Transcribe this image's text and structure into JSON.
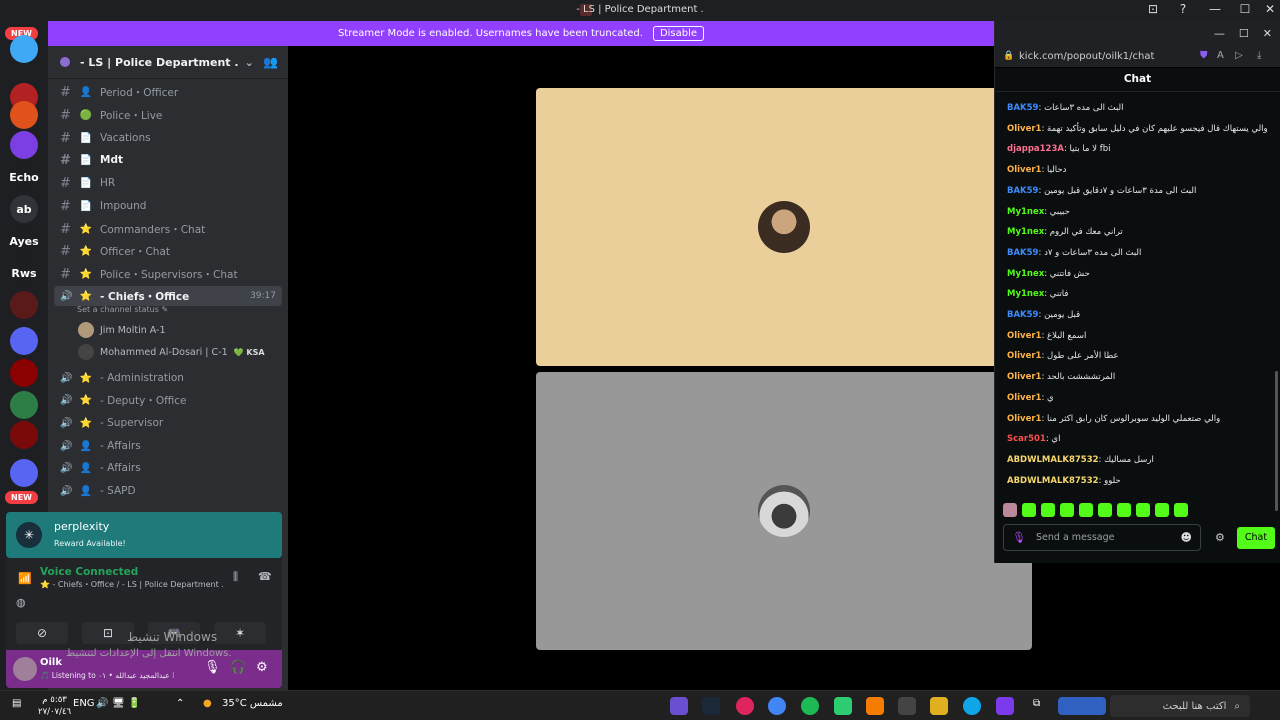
{
  "window": {
    "title": "- LS | Police Department .",
    "controls": [
      "⊡",
      "?",
      "—",
      "☐",
      "✕"
    ]
  },
  "rail": {
    "new_label": "NEW",
    "servers": [
      {
        "label": "",
        "color": "#3fa9f5",
        "badge": "1"
      },
      {
        "label": "",
        "color": "#b22222",
        "badge": "6"
      },
      {
        "label": "",
        "color": "#e0521b",
        "badge": "65"
      },
      {
        "label": "",
        "color": "#7b3fe4",
        "badge": ""
      },
      {
        "label": "Echo",
        "color": "#1e1f22",
        "badge": ""
      },
      {
        "label": "ab",
        "color": "#313338",
        "badge": ""
      },
      {
        "label": "Ayes",
        "color": "#1e1f22",
        "badge": "1"
      },
      {
        "label": "Rws",
        "color": "#1e1f22",
        "badge": "45"
      },
      {
        "label": "",
        "color": "#5a1a1a",
        "badge": "3"
      },
      {
        "label": "",
        "color": "#5865f2",
        "badge": ""
      },
      {
        "label": "",
        "color": "#8b0000",
        "badge": "1"
      },
      {
        "label": "",
        "color": "#2d7d46",
        "badge": "1"
      },
      {
        "label": "",
        "color": "#7a0a0a",
        "badge": ""
      },
      {
        "label": "",
        "color": "#5865f2",
        "badge": ""
      }
    ]
  },
  "banner": {
    "text": "Streamer Mode is enabled. Usernames have been truncated.",
    "disable_label": "Disable"
  },
  "guild": {
    "name": "- LS | Police Department .",
    "channels": [
      {
        "type": "text",
        "emoji": "👤",
        "label": "Period・Officer",
        "style": ""
      },
      {
        "type": "text",
        "emoji": "🟢",
        "label": "Police・Live",
        "style": ""
      },
      {
        "type": "text",
        "emoji": "📄",
        "label": "Vacations",
        "style": ""
      },
      {
        "type": "text",
        "emoji": "📄",
        "label": "Mdt",
        "style": "bold"
      },
      {
        "type": "text",
        "emoji": "📄",
        "label": "HR",
        "style": ""
      },
      {
        "type": "text",
        "emoji": "📄",
        "label": "Impound",
        "style": ""
      },
      {
        "type": "text",
        "emoji": "⭐",
        "label": "Commanders・Chat",
        "style": ""
      },
      {
        "type": "text",
        "emoji": "⭐",
        "label": "Officer・Chat",
        "style": ""
      },
      {
        "type": "text",
        "emoji": "⭐",
        "label": "Police・Supervisors・Chat",
        "style": ""
      },
      {
        "type": "voice",
        "emoji": "⭐",
        "label": "- Chiefs・Office",
        "style": "active",
        "timer": "39:17"
      },
      {
        "type": "voice",
        "emoji": "⭐",
        "label": "- Administration",
        "style": ""
      },
      {
        "type": "voice",
        "emoji": "⭐",
        "label": "- Deputy・Office",
        "style": ""
      },
      {
        "type": "voice",
        "emoji": "⭐",
        "label": "- Supervisor",
        "style": ""
      },
      {
        "type": "voice",
        "emoji": "👤",
        "label": "- Affairs",
        "style": ""
      },
      {
        "type": "voice",
        "emoji": "👤",
        "label": "- Affairs",
        "style": ""
      },
      {
        "type": "voice",
        "emoji": "👤",
        "label": "- SAPD",
        "style": ""
      }
    ],
    "channel_status": "Set a channel status ✎",
    "members": [
      {
        "name": "Jim Moltin A-1",
        "tag": ""
      },
      {
        "name": "Mohammed Al-Dosari | C-1",
        "tag": "💚 KSA"
      }
    ]
  },
  "perplexity": {
    "title": "perplexity",
    "subtitle": "Reward Available!"
  },
  "voice": {
    "connected": "Voice Connected",
    "location": "⭐ - Chiefs・Office / - LS | Police Department .",
    "buttons": [
      "⊘",
      "⊡",
      "🎮",
      "✶"
    ]
  },
  "watermark": {
    "line1": "تنشيط Windows",
    "line2": "انتقل إلى الإعدادات لتنشيط Windows."
  },
  "user": {
    "name": "Oilk",
    "status": "🎵 Listening to عبدالمجيد عبدالله • ٠١ ⁝"
  },
  "browser": {
    "controls": [
      "—",
      "☐",
      "✕"
    ],
    "url": "kick.com/popout/oilk1/chat"
  },
  "chat": {
    "title": "Chat",
    "messages": [
      {
        "user": "BAK59",
        "color": "#3d8cff",
        "text": "البث الى مده ٣ساعات"
      },
      {
        "user": "Oliver1",
        "color": "#ffb347",
        "text": "والي يستهاك قال فيجسو عليهم كان في دليل سابق وتأكيد تهمة"
      },
      {
        "user": "djappa123A",
        "color": "#ff6f91",
        "text": "لا ما بتيا fbi"
      },
      {
        "user": "Oliver1",
        "color": "#ffb347",
        "text": "دحاليا"
      },
      {
        "user": "BAK59",
        "color": "#3d8cff",
        "text": "البث الى مدة ٣ساعات و ٧دقايق قبل يومين"
      },
      {
        "user": "My1nex",
        "color": "#53fc18",
        "text": "حبيبي"
      },
      {
        "user": "My1nex",
        "color": "#53fc18",
        "text": "تراني معك في الروم"
      },
      {
        "user": "BAK59",
        "color": "#3d8cff",
        "text": "البث الى مده ٣ساعات و ٧د"
      },
      {
        "user": "My1nex",
        "color": "#53fc18",
        "text": "حش فاتتني"
      },
      {
        "user": "My1nex",
        "color": "#53fc18",
        "text": "فاتني"
      },
      {
        "user": "BAK59",
        "color": "#3d8cff",
        "text": "قبل يومين"
      },
      {
        "user": "Oliver1",
        "color": "#ffb347",
        "text": "اسمع البلاغ"
      },
      {
        "user": "Oliver1",
        "color": "#ffb347",
        "text": "عطا الأمر على طول"
      },
      {
        "user": "Oliver1",
        "color": "#ffb347",
        "text": "المرتشششت بالحد"
      },
      {
        "user": "Oliver1",
        "color": "#ffb347",
        "text": "ي"
      },
      {
        "user": "Oliver1",
        "color": "#ffb347",
        "text": "والي صتعملي الوليد سوبرالوس كان رابق اكثر منا"
      },
      {
        "user": "Scar501",
        "color": "#ff4d4d",
        "text": "اي"
      },
      {
        "user": "ABDWLMALK87532",
        "color": "#f5d76e",
        "text": "ارسل مساليك"
      },
      {
        "user": "ABDWLMALK87532",
        "color": "#f5d76e",
        "text": "حلوو"
      }
    ],
    "input_placeholder": "Send a message",
    "send_label": "Chat"
  },
  "taskbar": {
    "search_text": "اكتب هنا للبحث",
    "weather": "35°C  مشمس",
    "lang": "ENG",
    "time": "٥:٥٣ م",
    "date": "٢٧/٠٧/٤٦"
  }
}
